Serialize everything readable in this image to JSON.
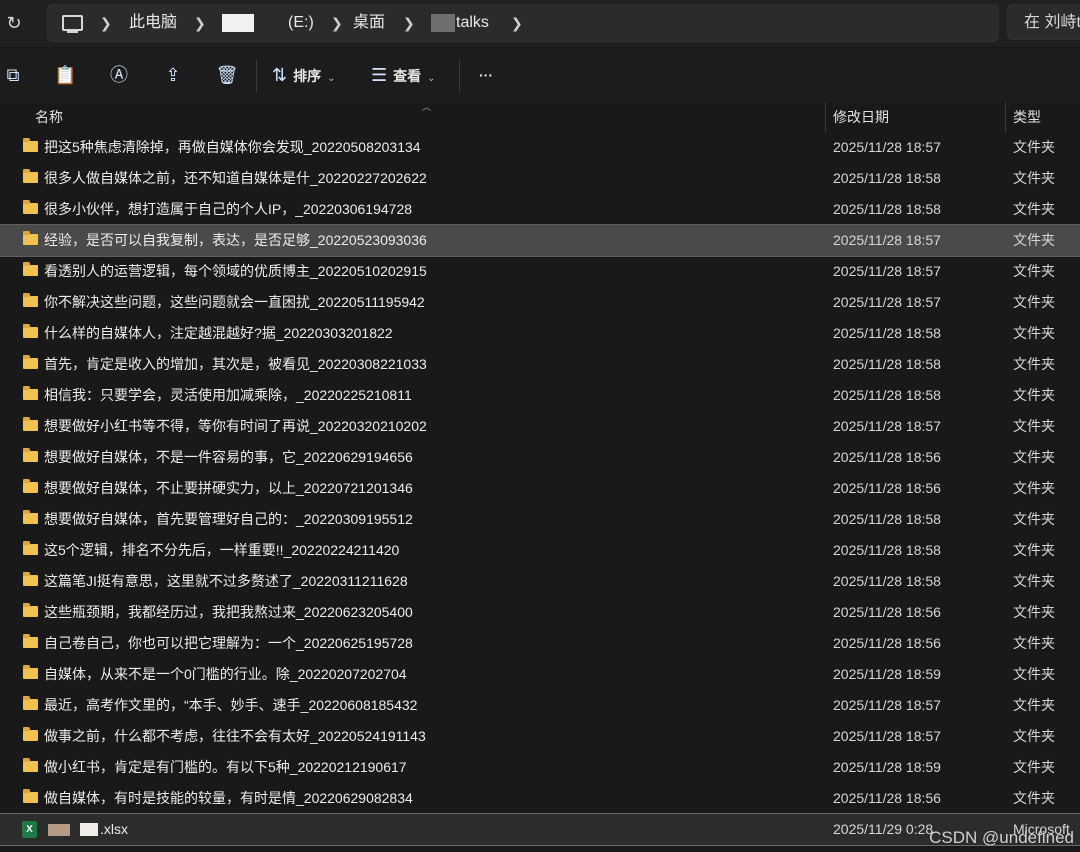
{
  "breadcrumbs": {
    "this_pc": "此电脑",
    "drive": "(E:)",
    "desktop": "桌面",
    "folder": "talks"
  },
  "search": {
    "placeholder": "在 刘峙t"
  },
  "toolbar": {
    "sort_label": "排序",
    "view_label": "查看",
    "more_label": "···"
  },
  "columns": {
    "name": "名称",
    "modified": "修改日期",
    "type": "类型"
  },
  "rows": [
    {
      "name": "把这5种焦虑清除掉，再做自媒体你会发现_20220508203134",
      "date": "2025/11/28 18:57",
      "type": "文件夹"
    },
    {
      "name": "很多人做自媒体之前，还不知道自媒体是什_20220227202622",
      "date": "2025/11/28 18:58",
      "type": "文件夹"
    },
    {
      "name": "很多小伙伴，想打造属于自己的个人IP，_20220306194728",
      "date": "2025/11/28 18:58",
      "type": "文件夹"
    },
    {
      "name": "经验，是否可以自我复制，表达，是否足够_20220523093036",
      "date": "2025/11/28 18:57",
      "type": "文件夹"
    },
    {
      "name": "看透别人的运营逻辑，每个领域的优质博主_20220510202915",
      "date": "2025/11/28 18:57",
      "type": "文件夹"
    },
    {
      "name": "你不解决这些问题，这些问题就会一直困扰_20220511195942",
      "date": "2025/11/28 18:57",
      "type": "文件夹"
    },
    {
      "name": "什么样的自媒体人，注定越混越好?据_20220303201822",
      "date": "2025/11/28 18:58",
      "type": "文件夹"
    },
    {
      "name": "首先，肯定是收入的增加，其次是，被看见_20220308221033",
      "date": "2025/11/28 18:58",
      "type": "文件夹"
    },
    {
      "name": "相信我：只要学会，灵活使用加减乘除，_20220225210811",
      "date": "2025/11/28 18:58",
      "type": "文件夹"
    },
    {
      "name": "想要做好小红书等不得，等你有时间了再说_20220320210202",
      "date": "2025/11/28 18:57",
      "type": "文件夹"
    },
    {
      "name": "想要做好自媒体，不是一件容易的事，它_20220629194656",
      "date": "2025/11/28 18:56",
      "type": "文件夹"
    },
    {
      "name": "想要做好自媒体，不止要拼硬实力，以上_20220721201346",
      "date": "2025/11/28 18:56",
      "type": "文件夹"
    },
    {
      "name": "想要做好自媒体，首先要管理好自己的：_20220309195512",
      "date": "2025/11/28 18:58",
      "type": "文件夹"
    },
    {
      "name": "这5个逻辑，排名不分先后，一样重要!!_20220224211420",
      "date": "2025/11/28 18:58",
      "type": "文件夹"
    },
    {
      "name": "这篇笔JI挺有意思，这里就不过多赘述了_20220311211628",
      "date": "2025/11/28 18:58",
      "type": "文件夹"
    },
    {
      "name": "这些瓶颈期，我都经历过，我把我熬过来_20220623205400",
      "date": "2025/11/28 18:56",
      "type": "文件夹"
    },
    {
      "name": "自己卷自己，你也可以把它理解为：一个_20220625195728",
      "date": "2025/11/28 18:56",
      "type": "文件夹"
    },
    {
      "name": "自媒体，从来不是一个0门槛的行业。除_20220207202704",
      "date": "2025/11/28 18:59",
      "type": "文件夹"
    },
    {
      "name": "最近，高考作文里的，“本手、妙手、速手_20220608185432",
      "date": "2025/11/28 18:57",
      "type": "文件夹"
    },
    {
      "name": "做事之前，什么都不考虑，往往不会有太好_20220524191143",
      "date": "2025/11/28 18:57",
      "type": "文件夹"
    },
    {
      "name": "做小红书，肯定是有门槛的。有以下5种_20220212190617",
      "date": "2025/11/28 18:59",
      "type": "文件夹"
    },
    {
      "name": "做自媒体，有时是技能的较量，有时是情_20220629082834",
      "date": "2025/11/28 18:56",
      "type": "文件夹"
    }
  ],
  "selected_row": 3,
  "xlsx_row": {
    "name": ".xlsx",
    "date": "2025/11/29 0:28",
    "type": "Microsoft"
  },
  "watermark": "CSDN @undefined",
  "colors": {
    "folder": "#f2c24e",
    "excel": "#1d7a45",
    "background": "#191919"
  }
}
